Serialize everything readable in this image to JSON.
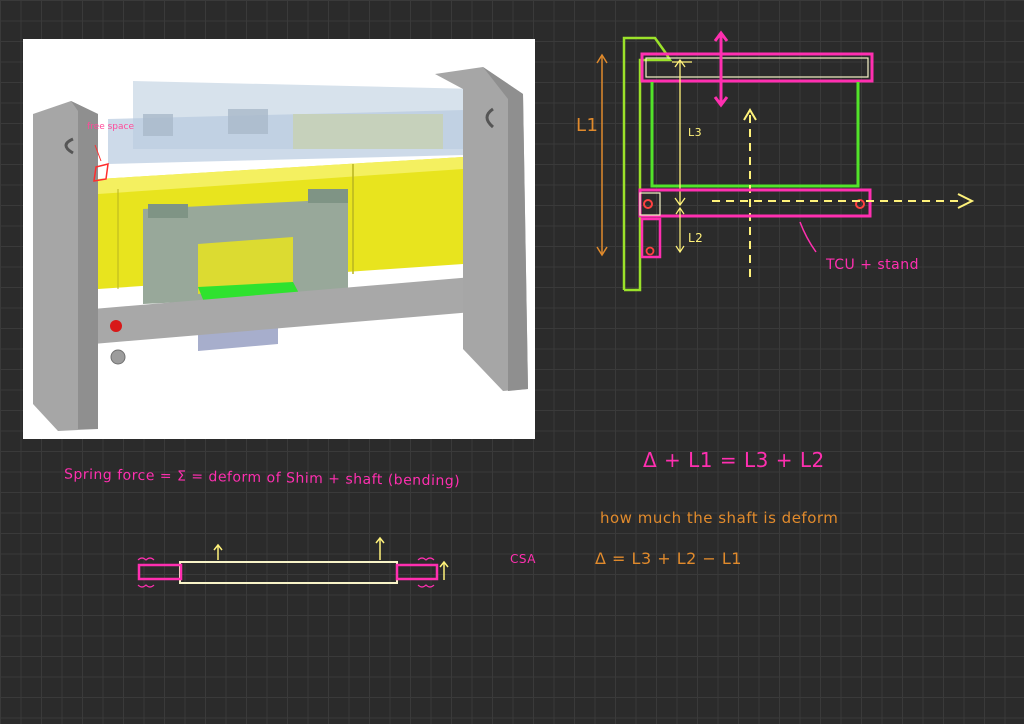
{
  "cad_render": {
    "note": "free space"
  },
  "diagram": {
    "l1": "L1",
    "l3": "L3",
    "l2": "L2",
    "tcu_label": "TCU + stand"
  },
  "notes": {
    "spring_force": "Spring force  =  Σ = deform of Shim  +  shaft (bending)",
    "relation": "Δ + L1 = L3 + L2",
    "question": "how much the shaft is deform",
    "csa": "CSA",
    "delta_formula": "Δ  =  L3 + L2 − L1"
  },
  "colors": {
    "background": "#2b2b2b",
    "grid": "#3a3a3a",
    "orange": "#e08a2c",
    "magenta": "#ff2fb0",
    "green": "#52e32a",
    "yellow": "#fff27a",
    "cream": "#f8f4c8",
    "lime": "#9be22a"
  }
}
